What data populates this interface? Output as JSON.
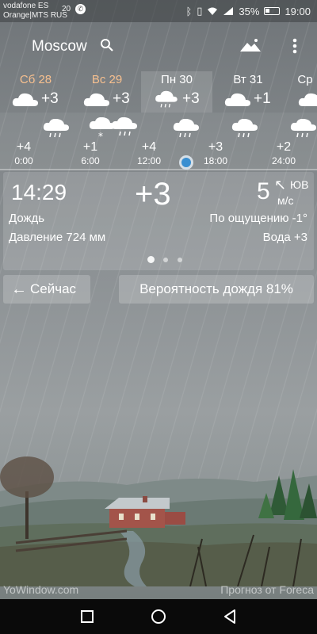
{
  "status_bar": {
    "carrier1": "vodafone ES",
    "carrier2": "Orange|MTS RUS",
    "notif_num": "20",
    "battery": "35%",
    "time": "19:00"
  },
  "header": {
    "city": "Moscow"
  },
  "days": [
    {
      "label": "Сб 28",
      "temp": "+3",
      "weekend": true
    },
    {
      "label": "Вс 29",
      "temp": "+3",
      "weekend": true
    },
    {
      "label": "Пн 30",
      "temp": "+3",
      "weekend": false,
      "selected": true
    },
    {
      "label": "Вт 31",
      "temp": "+1",
      "weekend": false
    },
    {
      "label": "Ср",
      "temp": "",
      "weekend": false
    }
  ],
  "hours": [
    {
      "temp": "+4",
      "time": "0:00"
    },
    {
      "temp": "+1",
      "time": "6:00"
    },
    {
      "temp": "+4",
      "time": "12:00"
    },
    {
      "temp": "+3",
      "time": "18:00"
    },
    {
      "temp": "+2",
      "time": "24:00"
    }
  ],
  "current": {
    "time": "14:29",
    "temp": "+3",
    "wind_speed": "5",
    "wind_dir": "ЮВ",
    "wind_unit": "м/с",
    "condition": "Дождь",
    "feels_like": "По ощущению -1°",
    "pressure": "Давление 724 мм",
    "water": "Вода +3"
  },
  "buttons": {
    "now": "Сейчас",
    "rain_probability": "Вероятность дождя 81%"
  },
  "footer": {
    "brand": "YoWindow.com",
    "forecast_by": "Прогноз от Foreca"
  },
  "colors": {
    "weekend": "#f7c08f",
    "slider_knob": "#3a8fd1"
  }
}
